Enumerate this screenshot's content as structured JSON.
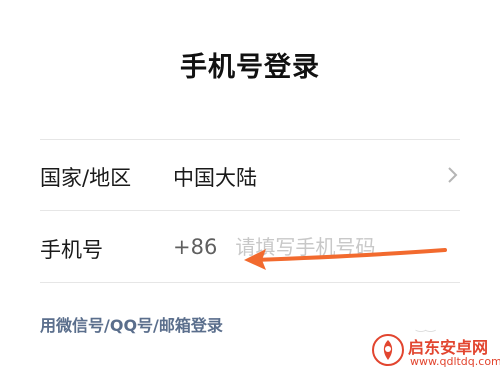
{
  "header": {
    "title": "手机号登录"
  },
  "form": {
    "country_row": {
      "label": "国家/地区",
      "value": "中国大陆",
      "chevron_icon": "chevron-right-icon"
    },
    "phone_row": {
      "label": "手机号",
      "country_code": "+86",
      "placeholder": "请填写手机号码"
    }
  },
  "alt_login": {
    "label": "用微信号/QQ号/邮箱登录"
  },
  "annotation": {
    "arrow_color": "#f26a2e"
  },
  "watermark": {
    "name": "启东安卓网",
    "url": "www.qdltdq.com",
    "color": "#e2452f"
  }
}
